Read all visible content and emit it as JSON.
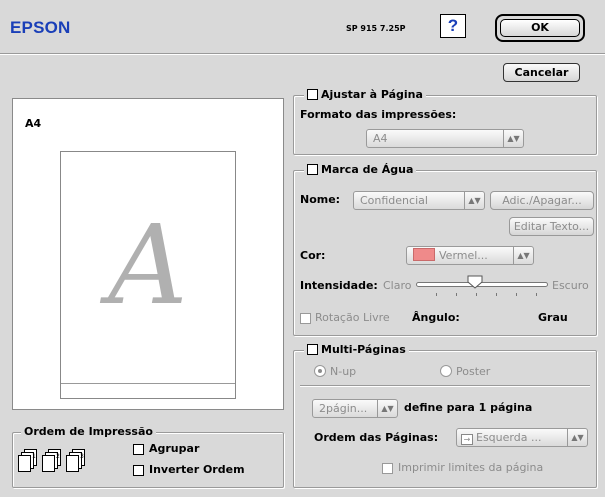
{
  "header": {
    "brand": "EPSON",
    "model": "SP 915 7.25P",
    "help_label": "?",
    "ok_label": "OK",
    "cancel_label": "Cancelar"
  },
  "preview": {
    "paper_size": "A4",
    "watermark_letter": "A"
  },
  "print_order": {
    "title": "Ordem de Impressão",
    "collate_label": "Agrupar",
    "reverse_label": "Inverter Ordem",
    "collate_checked": false,
    "reverse_checked": false
  },
  "fit_to_page": {
    "title": "Ajustar à Página",
    "checked": false,
    "format_label": "Formato das impressões:",
    "format_value": "A4"
  },
  "watermark": {
    "title": "Marca de Água",
    "checked": false,
    "name_label": "Nome:",
    "name_value": "Confidencial",
    "add_delete_label": "Adic./Apagar...",
    "edit_text_label": "Editar Texto...",
    "color_label": "Cor:",
    "color_value": "Vermel...",
    "color_swatch": "#ef8a8a",
    "intensity_label": "Intensidade:",
    "intensity_low": "Claro",
    "intensity_high": "Escuro",
    "intensity_level": 0.45,
    "free_rotation_label": "Rotação Livre",
    "angle_label": "Ângulo:",
    "angle_unit": "Grau"
  },
  "multi_page": {
    "title": "Multi-Páginas",
    "checked": false,
    "nup_label": "N-up",
    "poster_label": "Poster",
    "selected": "N-up",
    "pages_value": "2págin...",
    "per_page_label": "define para 1 página",
    "page_order_label": "Ordem das Páginas:",
    "page_order_value": "Esquerda ...",
    "print_borders_label": "Imprimir limites da página"
  },
  "colors": {
    "background": "#d9d9d9",
    "brand": "#1a3fb8",
    "disabled_text": "#8c8c8c"
  }
}
